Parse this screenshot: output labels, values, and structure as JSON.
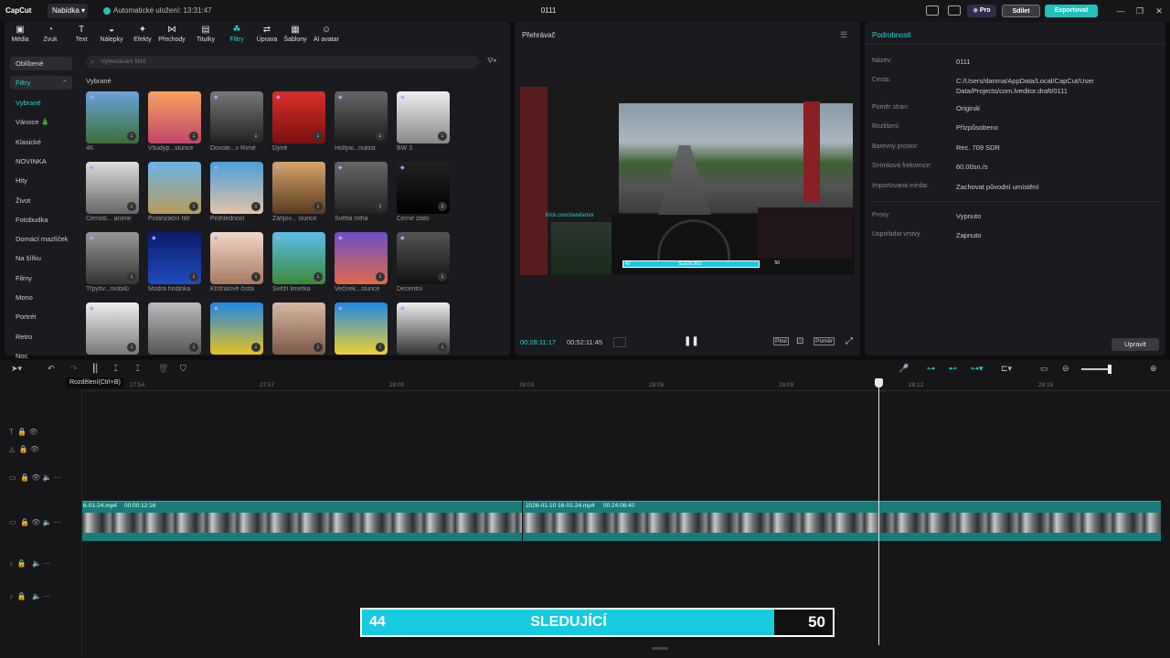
{
  "titlebar": {
    "logo": "CapCut",
    "menu": "Nabídka",
    "autosave": "Automatické uložení: 13:31:47",
    "project_title": "0111",
    "pro": "Pro",
    "share": "Sdílet",
    "export": "Exportovat"
  },
  "toolbar": {
    "tools": [
      "Média",
      "Zvuk",
      "Text",
      "Nálepky",
      "Efekty",
      "Přechody",
      "Titulky",
      "Filtry",
      "Úprava",
      "Šablony",
      "AI avatar"
    ],
    "active": "Filtry"
  },
  "sidebar": {
    "favorites": "Oblíbené",
    "filters": "Filtry",
    "items": [
      "Vybrané",
      "Vánoce 🎄",
      "Klasické",
      "NOVINKA",
      "Hity",
      "Život",
      "Fotobudka",
      "Domácí mazlíček",
      "Na šířku",
      "Filmy",
      "Mono",
      "Portrét",
      "Retro",
      "Noc"
    ]
  },
  "search": {
    "placeholder": "Vyhledávání filtrů"
  },
  "section_title": "Vybrané",
  "filters": [
    {
      "label": "4K",
      "bg": "linear-gradient(#6aa2d8,#3d6e3a)"
    },
    {
      "label": "Všudyp...slunce",
      "bg": "linear-gradient(#f7a35c,#c2456b)"
    },
    {
      "label": "Dovole...v Římě",
      "bg": "linear-gradient(#777,#222)"
    },
    {
      "label": "Dýně",
      "bg": "linear-gradient(#d9302a,#7a0f0f)"
    },
    {
      "label": "Hollyw...nulost",
      "bg": "linear-gradient(#666,#1c1c1c)"
    },
    {
      "label": "BW 3",
      "bg": "linear-gradient(#eee,#888)"
    },
    {
      "label": "Černob... anime",
      "bg": "linear-gradient(#ddd,#666)"
    },
    {
      "label": "Polarizační filtr",
      "bg": "linear-gradient(#6ab4e8,#b89b5a)"
    },
    {
      "label": "Průhlednost",
      "bg": "linear-gradient(#4a9fd8,#e6c2a8)"
    },
    {
      "label": "Zářijov... slunce",
      "bg": "linear-gradient(#d6a56a,#5a3a22)"
    },
    {
      "label": "Světlá mlha",
      "bg": "linear-gradient(#666,#222)"
    },
    {
      "label": "Černé zlato",
      "bg": "linear-gradient(#222,#000)"
    },
    {
      "label": "Třpytiv...mobilů",
      "bg": "linear-gradient(#999,#333)"
    },
    {
      "label": "Modrá hodinka",
      "bg": "linear-gradient(#0b1b6a,#1f4cc2)"
    },
    {
      "label": "Křišťálově čistá",
      "bg": "linear-gradient(#f1d8c8,#a87860)"
    },
    {
      "label": "Svěží limetka",
      "bg": "linear-gradient(#5dbde8,#3a8a3a)"
    },
    {
      "label": "Večírek...slunce",
      "bg": "linear-gradient(#6b4fc8,#e06a4a)"
    },
    {
      "label": "Decentní",
      "bg": "linear-gradient(#555,#111)"
    },
    {
      "label": "",
      "bg": "linear-gradient(#eee,#777)"
    },
    {
      "label": "",
      "bg": "linear-gradient(#bbb,#555)"
    },
    {
      "label": "",
      "bg": "linear-gradient(#1e88e5,#e8c020)"
    },
    {
      "label": "",
      "bg": "linear-gradient(#d8b8a0,#7a5a48)"
    },
    {
      "label": "",
      "bg": "linear-gradient(#1e88e5,#f0d030)"
    },
    {
      "label": "",
      "bg": "linear-gradient(#eee,#333)"
    }
  ],
  "player": {
    "title": "Přehrávač",
    "current_time": "00:28:11:17",
    "total_time": "00:52:11:45",
    "btn_full": "Plné",
    "btn_ratio": "Poměr",
    "video_caption": "Kick.com/dandamor",
    "mini_left": "42",
    "mini_mid": "SLEDUJÍCÍ",
    "mini_right": "50"
  },
  "details": {
    "title": "Podrobnosti",
    "rows": [
      {
        "label": "Název:",
        "value": "0111"
      },
      {
        "label": "Cesta:",
        "value": "C:/Users/danma/AppData/Local/CapCut/User Data/Projects/com.lveditor.draft/0111"
      },
      {
        "label": "Poměr stran:",
        "value": "Originál"
      },
      {
        "label": "Rozlišení:",
        "value": "Přizpůsobeno"
      },
      {
        "label": "Barevný prostor",
        "value": "Rec. 709 SDR"
      },
      {
        "label": "Snímková frekvence:",
        "value": "60.00sn./s"
      },
      {
        "label": "Importovaná média:",
        "value": "Zachovat původní umístění"
      },
      {
        "label": "Proxy:",
        "value": "Vypnuto"
      },
      {
        "label": "Uspořádat vrstvy",
        "value": "Zapnuto"
      }
    ],
    "edit": "Upravit"
  },
  "timeline": {
    "tooltip": "Rozdělení(Ctrl+B)",
    "ruler": [
      "27:54",
      "27:57",
      "28:00",
      "28:03",
      "28:06",
      "28:09",
      "28:12",
      "28:15"
    ],
    "clip1": {
      "name": "6-01-24.mp4",
      "duration": "00:00:12:16"
    },
    "clip2": {
      "name": "2026-01-10 16-01-24.mp4",
      "duration": "00:24:08:40"
    }
  },
  "overlay": {
    "left": "44",
    "mid": "SLEDUJÍCÍ",
    "right": "50"
  }
}
